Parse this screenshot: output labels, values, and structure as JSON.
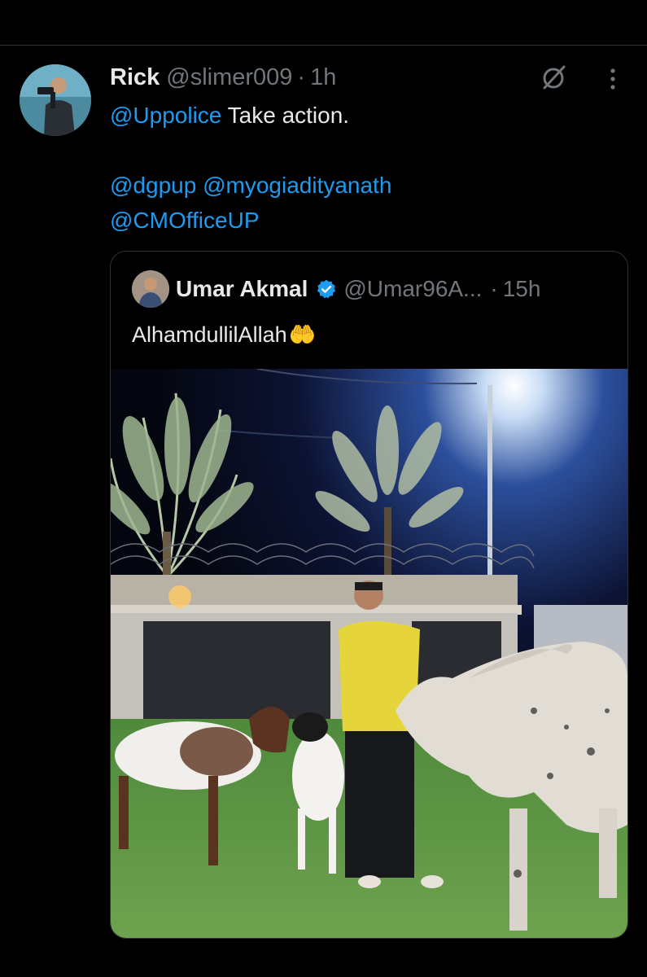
{
  "tweet": {
    "author_name": "Rick",
    "author_handle": "@slimer009",
    "separator": "·",
    "time": "1h",
    "text": {
      "mention_1": "@Uppolice",
      "body": " Take action.",
      "mention_2": "@dgpup",
      "mention_3": "@myogiadityanath",
      "mention_4": "@CMOfficeUP"
    }
  },
  "quoted_tweet": {
    "author_name": "Umar Akmal",
    "author_handle": "@Umar96A...",
    "separator": "·",
    "time": "15h",
    "text": "AlhamdullilAllah",
    "emoji": "🤲"
  },
  "colors": {
    "background": "#000000",
    "text": "#e7e9ea",
    "secondary_text": "#71767b",
    "accent": "#1d9bf0",
    "border": "#2f3336"
  },
  "icons": [
    "grok-icon",
    "more-options-icon",
    "verified-badge-icon"
  ]
}
